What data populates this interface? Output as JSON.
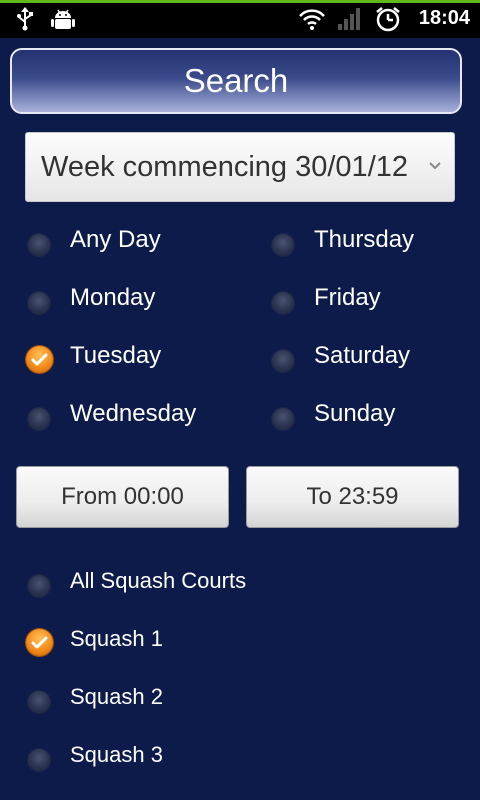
{
  "status_bar": {
    "time": "18:04",
    "icons": [
      "usb-icon",
      "android-debug-icon",
      "wifi-icon",
      "signal-icon",
      "alarm-icon"
    ],
    "accent_color": "#5fb91b"
  },
  "title": "Search",
  "week_select": {
    "value": "Week commencing 30/01/12"
  },
  "days": [
    {
      "label": "Any Day",
      "checked": false
    },
    {
      "label": "Thursday",
      "checked": false
    },
    {
      "label": "Monday",
      "checked": false
    },
    {
      "label": "Friday",
      "checked": false
    },
    {
      "label": "Tuesday",
      "checked": true
    },
    {
      "label": "Saturday",
      "checked": false
    },
    {
      "label": "Wednesday",
      "checked": false
    },
    {
      "label": "Sunday",
      "checked": false
    }
  ],
  "time_range": {
    "from_label": "From 00:00",
    "to_label": "To 23:59"
  },
  "courts": [
    {
      "label": "All Squash Courts",
      "checked": false
    },
    {
      "label": "Squash 1",
      "checked": true
    },
    {
      "label": "Squash 2",
      "checked": false
    },
    {
      "label": "Squash 3",
      "checked": false
    }
  ],
  "colors": {
    "background": "#0c1b4a",
    "checked_radio": "#f28c1a"
  }
}
